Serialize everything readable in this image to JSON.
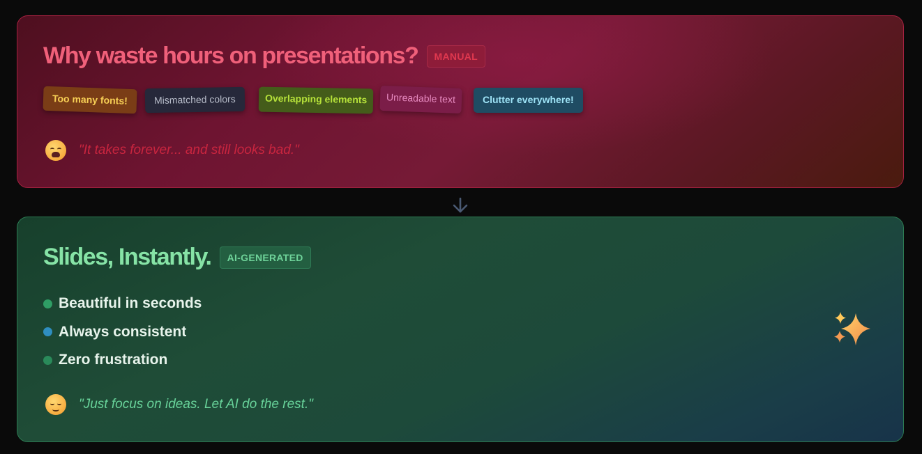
{
  "problem": {
    "title": "Why waste hours on presentations?",
    "badge": "MANUAL",
    "chips": [
      "Too many fonts!",
      "Mismatched colors",
      "Overlapping elements",
      "Unreadable text",
      "Clutter everywhere!"
    ],
    "emoji_icon": "tired-face-icon",
    "quote": "\"It takes forever... and still looks bad.\""
  },
  "arrow_icon": "arrow-down-icon",
  "solution": {
    "title": "Slides, Instantly.",
    "badge": "AI-GENERATED",
    "items": [
      {
        "label": "Beautiful in seconds",
        "dot_color": "#2f9e65"
      },
      {
        "label": "Always consistent",
        "dot_color": "#2f8ec0"
      },
      {
        "label": "Zero frustration",
        "dot_color": "#2a8a5a"
      }
    ],
    "emoji_icon": "relieved-face-icon",
    "quote": "\"Just focus on ideas. Let AI do the rest.\"",
    "sparkles_icon": "sparkles-icon"
  },
  "colors": {
    "problem_accent": "#f0607a",
    "solution_accent": "#86e3a6",
    "background": "#0a0a0a"
  }
}
